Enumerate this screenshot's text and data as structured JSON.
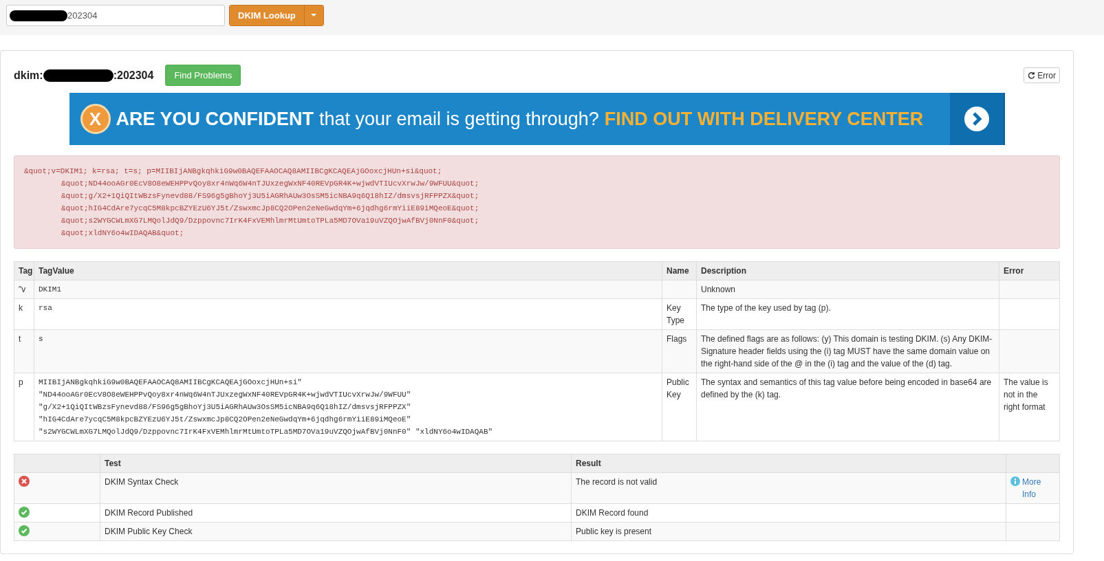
{
  "lookup": {
    "value": "202304",
    "button": "DKIM Lookup"
  },
  "record": {
    "prefix": "dkim:",
    "suffix": ":202304",
    "find_button": "Find Problems",
    "status_button": "Error"
  },
  "banner": {
    "logo": "X",
    "lead": "ARE YOU CONFIDENT",
    "middle": "that your email is getting through?",
    "cta": "FIND OUT WITH DELIVERY CENTER"
  },
  "raw_record": {
    "lines": [
      "&quot;v=DKIM1; k=rsa; t=s; p=MIIBIjANBgkqhkiG9w0BAQEFAAOCAQ8AMIIBCgKCAQEAjGOoxcjHUn+si&quot;",
      "&quot;ND44ooAGr0EcV8O8eWEHPPvQoy8xr4nWq6W4nTJUxzegWxNF40REVpGR4K+wjwdVTIUcvXrwJw/9WFUU&quot;",
      "&quot;g/X2+1QiQItWBzsFynevd88/FS96g5gBhoYj3U5iAGRhAUw3OsSM5icNBA9q6Q18hIZ/dmsvsjRFPPZX&quot;",
      "&quot;hIG4CdAre7ycqC5M8kpcBZYEzU6YJ5t/ZswxmcJp8CQ2OPen2eNeGwdqYm+6jqdhg6rmYiiE89iMQeoE&quot;",
      "&quot;s2WYGCWLmXG7LMQolJdQ9/Dzppovnc7IrK4FxVEMhlmrMtUmtoTPLa5MD7OVa19uVZQOjwAfBVj0NnF0&quot;",
      "&quot;xldNY6o4wIDAQAB&quot;"
    ]
  },
  "tag_table": {
    "columns": [
      "Tag",
      "TagValue",
      "Name",
      "Description",
      "Error"
    ],
    "rows": [
      {
        "tag": "\"v",
        "value": [
          "DKIM1"
        ],
        "name": "",
        "description": "Unknown",
        "error": ""
      },
      {
        "tag": "k",
        "value": [
          "rsa"
        ],
        "name": "Key Type",
        "description": "The type of the key used by tag (p).",
        "error": ""
      },
      {
        "tag": "t",
        "value": [
          "s"
        ],
        "name": "Flags",
        "description": "The defined flags are as follows: (y) This domain is testing DKIM. (s) Any DKIM-Signature header fields using the (i) tag MUST have the same domain value on the right-hand side of the @ in the (i) tag and the value of the (d) tag.",
        "error": ""
      },
      {
        "tag": "p",
        "value": [
          "MIIBIjANBgkqhkiG9w0BAQEFAAOCAQ8AMIIBCgKCAQEAjGOoxcjHUn+si\"",
          "\"ND44ooAGr0EcV8O8eWEHPPvQoy8xr4nWq6W4nTJUxzegWxNF40REVpGR4K+wjwdVTIUcvXrwJw/9WFUU\"",
          "\"g/X2+1QiQItWBzsFynevd88/FS96g5gBhoYj3U5iAGRhAUw3OsSM5icNBA9q6Q18hIZ/dmsvsjRFPPZX\"",
          "\"hIG4CdAre7ycqC5M8kpcBZYEzU6YJ5t/ZswxmcJp8CQ2OPen2eNeGwdqYm+6jqdhg6rmYiiE89iMQeoE\"",
          "\"s2WYGCWLmXG7LMQolJdQ9/Dzppovnc7IrK4FxVEMhlmrMtUmtoTPLa5MD7OVa19uVZQOjwAfBVj0NnF0\" \"xldNY6o4wIDAQAB\""
        ],
        "name": "Public Key",
        "description": "The syntax and semantics of this tag value before being encoded in base64 are defined by the (k) tag.",
        "error": "The value is not in the right format"
      }
    ]
  },
  "test_table": {
    "columns": [
      "Test",
      "Result"
    ],
    "rows": [
      {
        "kind": "error",
        "test": "DKIM Syntax Check",
        "result": "The record is not valid",
        "link": "More Info"
      },
      {
        "kind": "ok",
        "test": "DKIM Record Published",
        "result": "DKIM Record found",
        "link": ""
      },
      {
        "kind": "ok",
        "test": "DKIM Public Key Check",
        "result": "Public key is present",
        "link": ""
      }
    ]
  }
}
